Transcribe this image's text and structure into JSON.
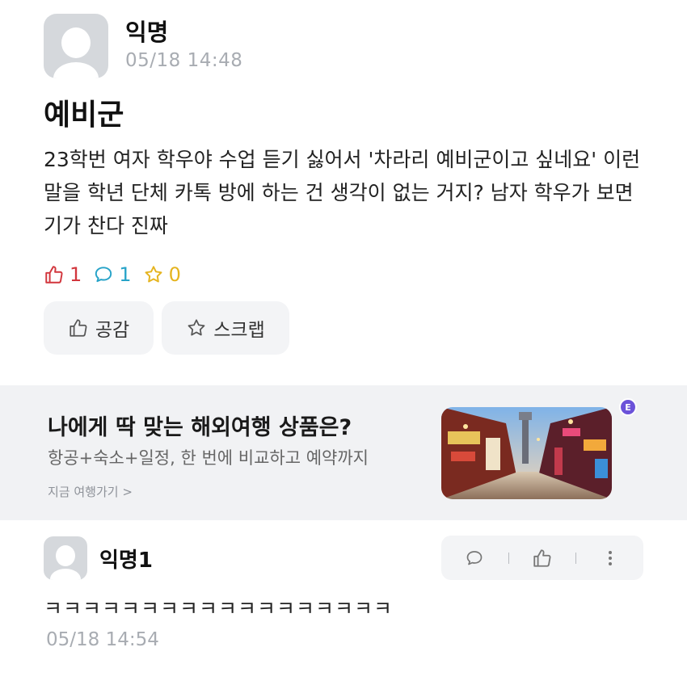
{
  "post": {
    "author": "익명",
    "time": "05/18 14:48",
    "title": "예비군",
    "body": "23학번 여자 학우야 수업 듣기 싫어서 '차라리 예비군이고 싶네요' 이런 말을 학년 단체 카톡 방에 하는 건 생각이 없는 거지? 남자 학우가 보면 기가 찬다 진짜",
    "likes": "1",
    "comments": "1",
    "scraps": "0",
    "like_button": "공감",
    "scrap_button": "스크랩"
  },
  "ad": {
    "title": "나에게 딱 맞는 해외여행 상품은?",
    "description": "항공+숙소+일정, 한 번에 비교하고 예약까지",
    "link": "지금 여행가기 >",
    "badge": "E"
  },
  "comment": {
    "author": "익명1",
    "text": "ㅋㅋㅋㅋㅋㅋㅋㅋㅋㅋㅋㅋㅋㅋㅋㅋㅋㅋ",
    "time": "05/18 14:54"
  },
  "colors": {
    "like": "#d2363d",
    "comment": "#27a3c8",
    "scrap": "#e5b41f",
    "muted": "#a8acb2"
  }
}
